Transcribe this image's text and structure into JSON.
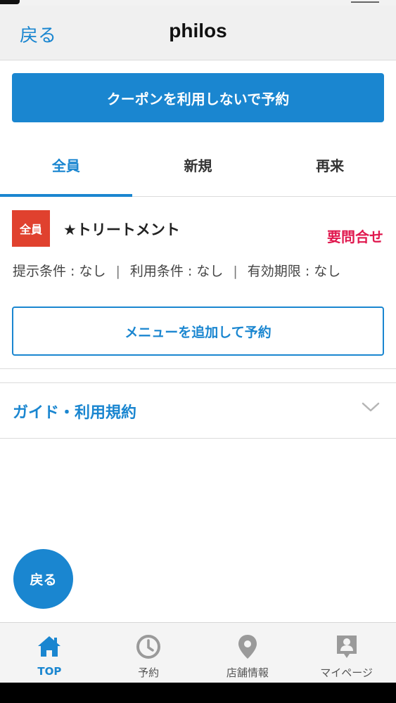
{
  "navbar": {
    "back_label": "戻る",
    "title": "philos"
  },
  "primary_button": {
    "label": "クーポンを利用しないで予約"
  },
  "tabs": [
    {
      "label": "全員",
      "active": true
    },
    {
      "label": "新規",
      "active": false
    },
    {
      "label": "再来",
      "active": false
    }
  ],
  "coupon": {
    "badge": "全員",
    "title": "★トリートメント",
    "price": "要問合せ",
    "conditions": {
      "present": "提示条件 : なし",
      "use": "利用条件 : なし",
      "expiry": "有効期限 : なし",
      "separator": "|"
    },
    "add_menu_button": "メニューを追加して予約"
  },
  "guide": {
    "label": "ガイド・利用規約"
  },
  "fab": {
    "label": "戻る"
  },
  "tabbar": {
    "items": [
      {
        "label": "TOP",
        "icon": "home-icon",
        "active": true
      },
      {
        "label": "予約",
        "icon": "clock-icon",
        "active": false
      },
      {
        "label": "店舗情報",
        "icon": "map-pin-icon",
        "active": false
      },
      {
        "label": "マイページ",
        "icon": "profile-icon",
        "active": false
      }
    ]
  },
  "colors": {
    "accent": "#1a86d0",
    "badge": "#e0412e",
    "price": "#e0184e",
    "inactive_icon": "#9a9a9a"
  }
}
